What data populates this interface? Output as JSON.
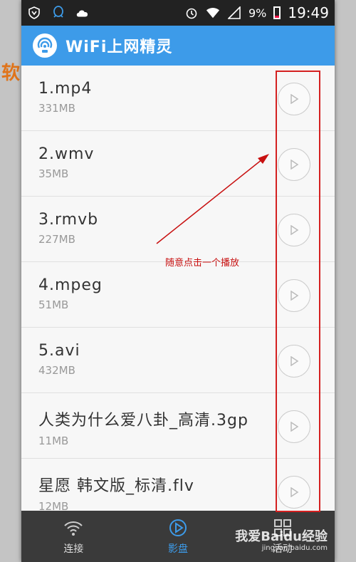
{
  "status": {
    "battery": "9%",
    "time": "19:49"
  },
  "app": {
    "title": "WiFi上网精灵"
  },
  "files": [
    {
      "name": "1.mp4",
      "size": "331MB"
    },
    {
      "name": "2.wmv",
      "size": "35MB"
    },
    {
      "name": "3.rmvb",
      "size": "227MB"
    },
    {
      "name": "4.mpeg",
      "size": "51MB"
    },
    {
      "name": "5.avi",
      "size": "432MB"
    },
    {
      "name": "人类为什么爱八卦_高清.3gp",
      "size": "11MB"
    },
    {
      "name": "星愿 韩文版_标清.flv",
      "size": "12MB"
    }
  ],
  "annotation": "随意点击一个播放",
  "tabs": [
    {
      "label": "连接",
      "icon": "wifi-icon"
    },
    {
      "label": "影盘",
      "icon": "play-circle-icon"
    },
    {
      "label": "活动",
      "icon": "grid-icon"
    }
  ],
  "watermark": {
    "main": "我爱Baidu经验",
    "url": "jingyan.baidu.com"
  },
  "colors": {
    "appbar": "#3d9be9",
    "highlight": "#d42020",
    "tabbar": "#3a3a3a"
  }
}
